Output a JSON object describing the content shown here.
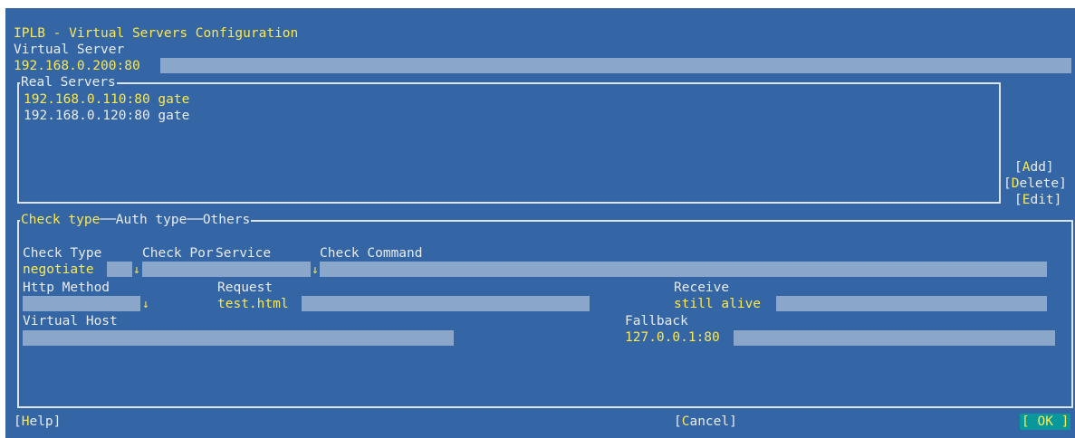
{
  "title": "IPLB - Virtual Servers Configuration",
  "virtual_server": {
    "label": "Virtual Server",
    "value": "192.168.0.200:80"
  },
  "real_servers": {
    "title": "Real Servers",
    "items": [
      {
        "text": "192.168.0.110:80 gate",
        "selected": true
      },
      {
        "text": "192.168.0.120:80 gate",
        "selected": false
      }
    ]
  },
  "side_buttons": {
    "add": {
      "open": "[",
      "hotkey": "A",
      "rest": "dd]"
    },
    "delete": {
      "open": "[",
      "hotkey": "D",
      "rest": "elete]"
    },
    "edit": {
      "open": "[",
      "hotkey": "E",
      "rest": "dit]"
    }
  },
  "tabs": {
    "check_type": "Check type",
    "auth_type": "Auth type",
    "others": "Others"
  },
  "check": {
    "check_type_label": "Check Type",
    "check_port_label": "Check Por",
    "service_label": "Service",
    "check_command_label": "Check Command",
    "check_type_value": "negotiate",
    "arrow": "↓",
    "http_method_label": "Http Method",
    "request_label": "Request",
    "request_value": "test.html",
    "receive_label": "Receive",
    "receive_value": "still alive",
    "virtual_host_label": "Virtual Host",
    "fallback_label": "Fallback",
    "fallback_value": "127.0.0.1:80"
  },
  "footer": {
    "help": {
      "open": "[",
      "hotkey": "H",
      "rest": "elp]"
    },
    "cancel": {
      "open": "[",
      "hotkey": "C",
      "rest": "ancel]"
    },
    "ok": "[ OK ]"
  },
  "colors": {
    "background": "#3465a4",
    "field": "#8aa7c9",
    "highlight": "#fce94f",
    "ok_button": "#06989a"
  }
}
